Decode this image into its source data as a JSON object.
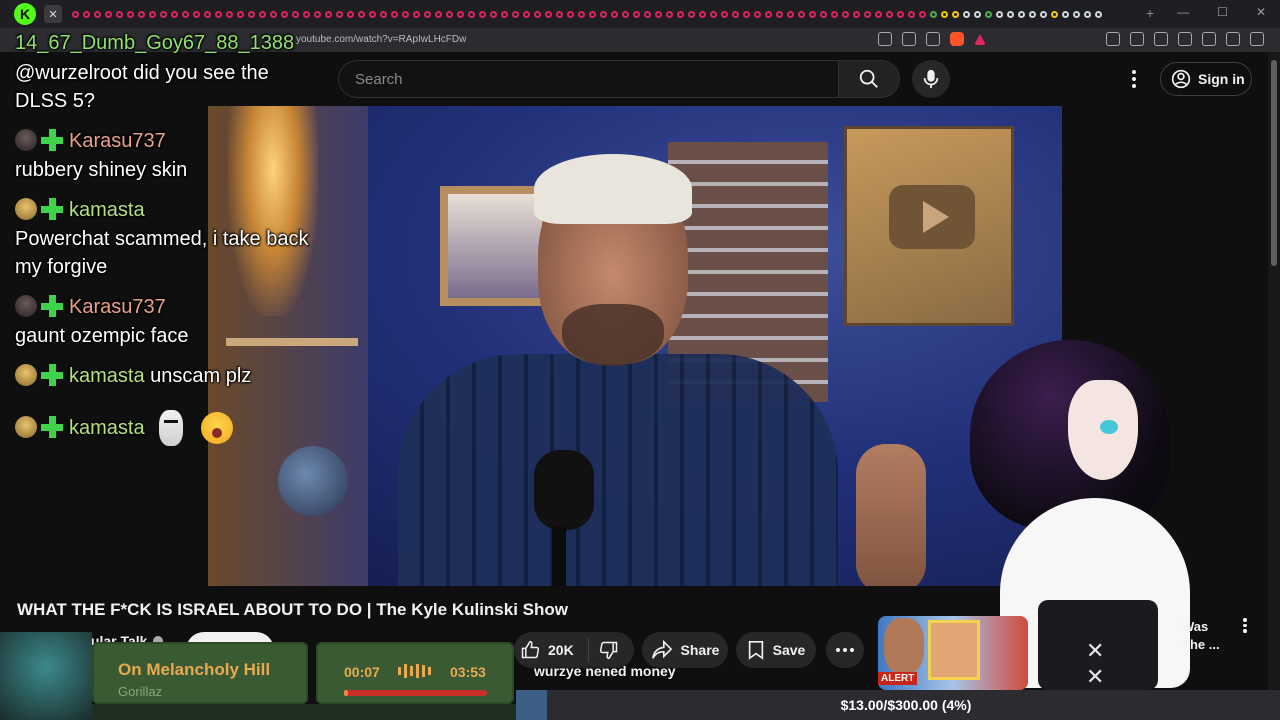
{
  "browser": {
    "url": "youtube.com/watch?v=RApIwLHcFDw"
  },
  "header": {
    "search_placeholder": "Search",
    "sign_in_label": "Sign in"
  },
  "chat": [
    {
      "user": "14_67_Dumb_Goy67_88_1388",
      "message": ""
    },
    {
      "user": "",
      "message": "@wurzelroot did you see the DLSS 5?"
    },
    {
      "user": "Karasu737",
      "message": "rubbery shiney skin"
    },
    {
      "user": "kamasta",
      "message": "Powerchat scammed, i take back my forgive"
    },
    {
      "user": "Karasu737",
      "message": "gaunt ozempic face"
    },
    {
      "user": "kamasta",
      "message": "unscam plz"
    },
    {
      "user": "kamasta",
      "message": ""
    }
  ],
  "chat_text": {
    "top_user": "14_67_Dumb_Goy67_88_1388",
    "msg1_line1": "@wurzelroot did you see the",
    "msg1_line2": "DLSS 5?",
    "user2": "Karasu737",
    "msg2": "rubbery shiney skin",
    "user3": "kamasta",
    "msg3_line1": "Powerchat scammed, i take back",
    "msg3_line2": "my forgive",
    "user4": "Karasu737",
    "msg4": "gaunt ozempic face",
    "user5": "kamasta",
    "msg5": "unscam plz",
    "user6": "kamasta"
  },
  "video": {
    "title": "WHAT THE F*CK IS ISRAEL ABOUT TO DO | The Kyle Kulinski Show",
    "channel": "Secular Talk",
    "likes": "20K",
    "share_label": "Share",
    "save_label": "Save",
    "caption": "wurzye nened money"
  },
  "recommendation": {
    "badge": "ALERT",
    "title_line1": "Was",
    "title_line2": "The ..."
  },
  "now_playing": {
    "song": "On Melancholy Hill",
    "artist": "Gorillaz",
    "current_time": "00:07",
    "total_time": "03:53",
    "progress": 0.03
  },
  "donation_goal": {
    "text": "$13.00/$300.00 (4%)",
    "progress": 0.04
  },
  "colors": {
    "kick_green": "#53fc18",
    "goal_fill": "#3d5f86",
    "np_accent": "#e9a94e"
  }
}
